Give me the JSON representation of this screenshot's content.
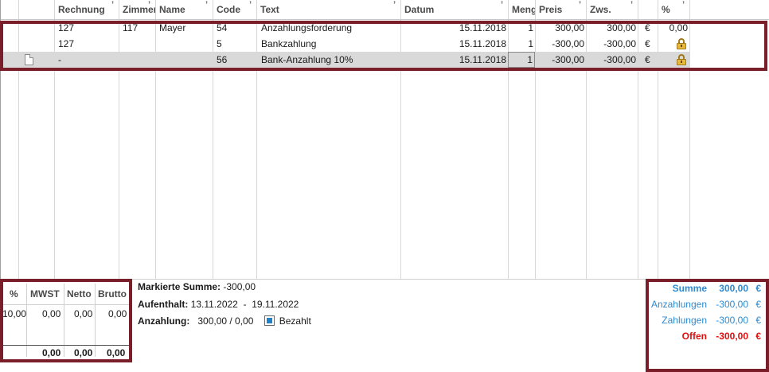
{
  "table": {
    "columns": [
      "",
      "",
      "Rechnung",
      "Zimmer",
      "Name",
      "Code",
      "Text",
      "Datum",
      "Menge",
      "Preis",
      "Zws.",
      "",
      "%"
    ],
    "rows": [
      {
        "rechnung": "127",
        "zimmer": "117",
        "name": "Mayer",
        "code": "54",
        "text": "Anzahlungsforderung",
        "datum": "15.11.2018",
        "menge": "1",
        "preis": "300,00",
        "zws": "300,00",
        "currency": "€",
        "percent": "0,00",
        "locked": false,
        "selected": false
      },
      {
        "rechnung": "127",
        "zimmer": "",
        "name": "",
        "code": "5",
        "text": "Bankzahlung",
        "datum": "15.11.2018",
        "menge": "1",
        "preis": "-300,00",
        "zws": "-300,00",
        "currency": "€",
        "percent": "",
        "locked": true,
        "selected": false
      },
      {
        "rechnung": "-",
        "zimmer": "",
        "name": "",
        "code": "56",
        "text": "Bank-Anzahlung 10%",
        "datum": "15.11.2018",
        "menge": "1",
        "preis": "-300,00",
        "zws": "-300,00",
        "currency": "€",
        "percent": "",
        "locked": true,
        "selected": true
      }
    ]
  },
  "tax": {
    "headers": [
      "%",
      "MWST",
      "Netto",
      "Brutto"
    ],
    "row": [
      "10,00",
      "0,00",
      "0,00",
      "0,00"
    ],
    "totals": [
      "0,00",
      "0,00",
      "0,00"
    ]
  },
  "info": {
    "marked_label": "Markierte Summe:",
    "marked_value": "-300,00",
    "stay_label": "Aufenthalt:",
    "stay_from": "13.11.2022",
    "stay_sep": "-",
    "stay_to": "19.11.2022",
    "deposit_label": "Anzahlung:",
    "deposit_value": "300,00 / 0,00",
    "paid_label": "Bezahlt",
    "paid_checked": true
  },
  "totals": {
    "sum_label": "Summe",
    "sum_value": "300,00",
    "sum_currency": "€",
    "deposits_label": "Anzahlungen",
    "deposits_value": "-300,00",
    "deposits_currency": "€",
    "payments_label": "Zahlungen",
    "payments_value": "-300,00",
    "payments_currency": "€",
    "open_label": "Offen",
    "open_value": "-300,00",
    "open_currency": "€"
  },
  "colors": {
    "accent_blue": "#2f8ad0",
    "open_red": "#e01010",
    "highlight_frame": "#7a1e2a",
    "selected_row": "#d9d9d9"
  },
  "icons": {
    "row_document": "document-icon",
    "locked": "lock-icon",
    "paid": "checkbox-checked"
  }
}
